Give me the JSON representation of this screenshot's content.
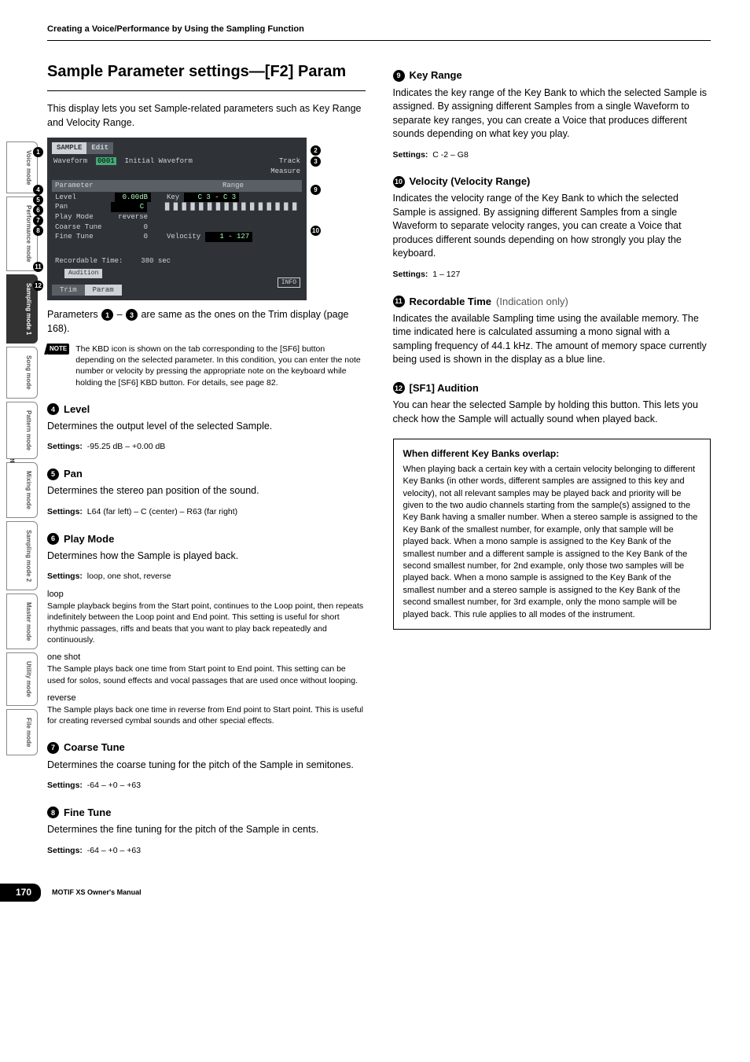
{
  "top_header": "Creating a Voice/Performance by Using the Sampling Function",
  "ref_label": "Reference",
  "side_tabs": [
    {
      "label": "Voice mode",
      "active": false
    },
    {
      "label": "Performance mode",
      "active": false
    },
    {
      "label": "Sampling mode 1",
      "active": true
    },
    {
      "label": "Song mode",
      "active": false
    },
    {
      "label": "Pattern mode",
      "active": false
    },
    {
      "label": "Mixing mode",
      "active": false
    },
    {
      "label": "Sampling mode 2",
      "active": false
    },
    {
      "label": "Master mode",
      "active": false
    },
    {
      "label": "Utility mode",
      "active": false
    },
    {
      "label": "File mode",
      "active": false
    }
  ],
  "section_title": "Sample Parameter settings—[F2] Param",
  "intro": "This display lets you set Sample-related parameters such as Key Range and Velocity Range.",
  "lcd": {
    "tab_sample": "SAMPLE",
    "tab_edit": "Edit",
    "waveform_lbl": "Waveform",
    "waveform_num": "0001",
    "waveform_name": "Initial Waveform",
    "track_lbl": "Track",
    "measure_lbl": "Measure",
    "param_hdr": "Parameter",
    "range_hdr": "Range",
    "level_lbl": "Level",
    "level_val": "0.00dB",
    "pan_lbl": "Pan",
    "pan_val": "C",
    "playmode_lbl": "Play Mode",
    "playmode_val": "reverse",
    "coarse_lbl": "Coarse Tune",
    "coarse_val": "0",
    "fine_lbl": "Fine Tune",
    "fine_val": "0",
    "key_lbl": "Key",
    "key_val": "C  3 - C  3",
    "vel_lbl": "Velocity",
    "vel_val": "1 -  127",
    "rectime_lbl": "Recordable Time:",
    "rectime_val": "380 sec",
    "aud": "Audition",
    "bt_trim": "Trim",
    "bt_param": "Param",
    "info": "INFO"
  },
  "trim_ref_a": "Parameters ",
  "trim_ref_b": " – ",
  "trim_ref_c": " are same as the ones on the Trim display (page 168).",
  "note_tag": "NOTE",
  "note_text": "The KBD icon is shown on the tab corresponding to the [SF6] button depending on the selected parameter. In this condition, you can enter the note number or velocity by pressing the appropriate note on the keyboard while holding the [SF6] KBD button. For details, see page 82.",
  "params": {
    "p4": {
      "n": "4",
      "title": "Level",
      "body": "Determines the output level of the selected Sample.",
      "settings": "-95.25 dB – +0.00 dB"
    },
    "p5": {
      "n": "5",
      "title": "Pan",
      "body": "Determines the stereo pan position of the sound.",
      "settings": "L64 (far left) – C (center) – R63 (far right)"
    },
    "p6": {
      "n": "6",
      "title": "Play Mode",
      "body": "Determines how the Sample is played back.",
      "settings": "loop, one shot, reverse",
      "subs": [
        {
          "h": "loop",
          "t": "Sample playback begins from the Start point, continues to the Loop point, then repeats indefinitely between the Loop point and End point. This setting is useful for short rhythmic passages, riffs and beats that you want to play back repeatedly and continuously."
        },
        {
          "h": "one shot",
          "t": "The Sample plays back one time from Start point to End point. This setting can be used for solos, sound effects and vocal passages that are used once without looping."
        },
        {
          "h": "reverse",
          "t": "The Sample plays back one time in reverse from End point to Start point. This is useful for creating reversed cymbal sounds and other special effects."
        }
      ]
    },
    "p7": {
      "n": "7",
      "title": "Coarse Tune",
      "body": "Determines the coarse tuning for the pitch of the Sample in semitones.",
      "settings": "-64 – +0 – +63"
    },
    "p8": {
      "n": "8",
      "title": "Fine Tune",
      "body": "Determines the fine tuning for the pitch of the Sample in cents.",
      "settings": "-64 – +0 – +63"
    },
    "p9": {
      "n": "9",
      "title": "Key Range",
      "body": "Indicates the key range of the Key Bank to which the selected Sample is assigned. By assigning different Samples from a single Waveform to separate key ranges, you can create a Voice that produces different sounds depending on what key you play.",
      "settings": "C -2 – G8"
    },
    "p10": {
      "n": "10",
      "title": "Velocity (Velocity Range)",
      "body": "Indicates the velocity range of the Key Bank to which the selected Sample is assigned. By assigning different Samples from a single Waveform to separate velocity ranges, you can create a Voice that produces different sounds depending on how strongly you play the keyboard.",
      "settings": "1 – 127"
    },
    "p11": {
      "n": "11",
      "title": "Recordable Time",
      "note_in": "(Indication only)",
      "body": "Indicates the available Sampling time using the available memory. The time indicated here is calculated assuming a mono signal with a sampling frequency of 44.1 kHz. The amount of memory space currently being used is shown in the display as a blue line."
    },
    "p12": {
      "n": "12",
      "title": "[SF1] Audition",
      "body": "You can hear the selected Sample by holding this button. This lets you check how the Sample will actually sound when played back."
    }
  },
  "info_box": {
    "h": "When different Key Banks overlap:",
    "t": "When playing back a certain key with a certain velocity belonging to different Key Banks (in other words, different samples are assigned to this key and velocity), not all relevant samples may be played back and priority will be given to the two audio channels starting from the sample(s) assigned to the Key Bank having a smaller number. When a stereo sample is assigned to the Key Bank of the smallest number, for example, only that sample will be played back. When a mono sample is assigned to the Key Bank of the smallest number and a different sample is assigned to the Key Bank of the second smallest number, for 2nd example, only those two samples will be played back. When a mono sample is assigned to the Key Bank of the smallest number and a stereo sample is assigned to the Key Bank of the second smallest number, for 3rd example, only the mono sample will be played back. This rule applies to all modes of the instrument."
  },
  "footer": {
    "page": "170",
    "label": "MOTIF XS Owner's Manual"
  }
}
